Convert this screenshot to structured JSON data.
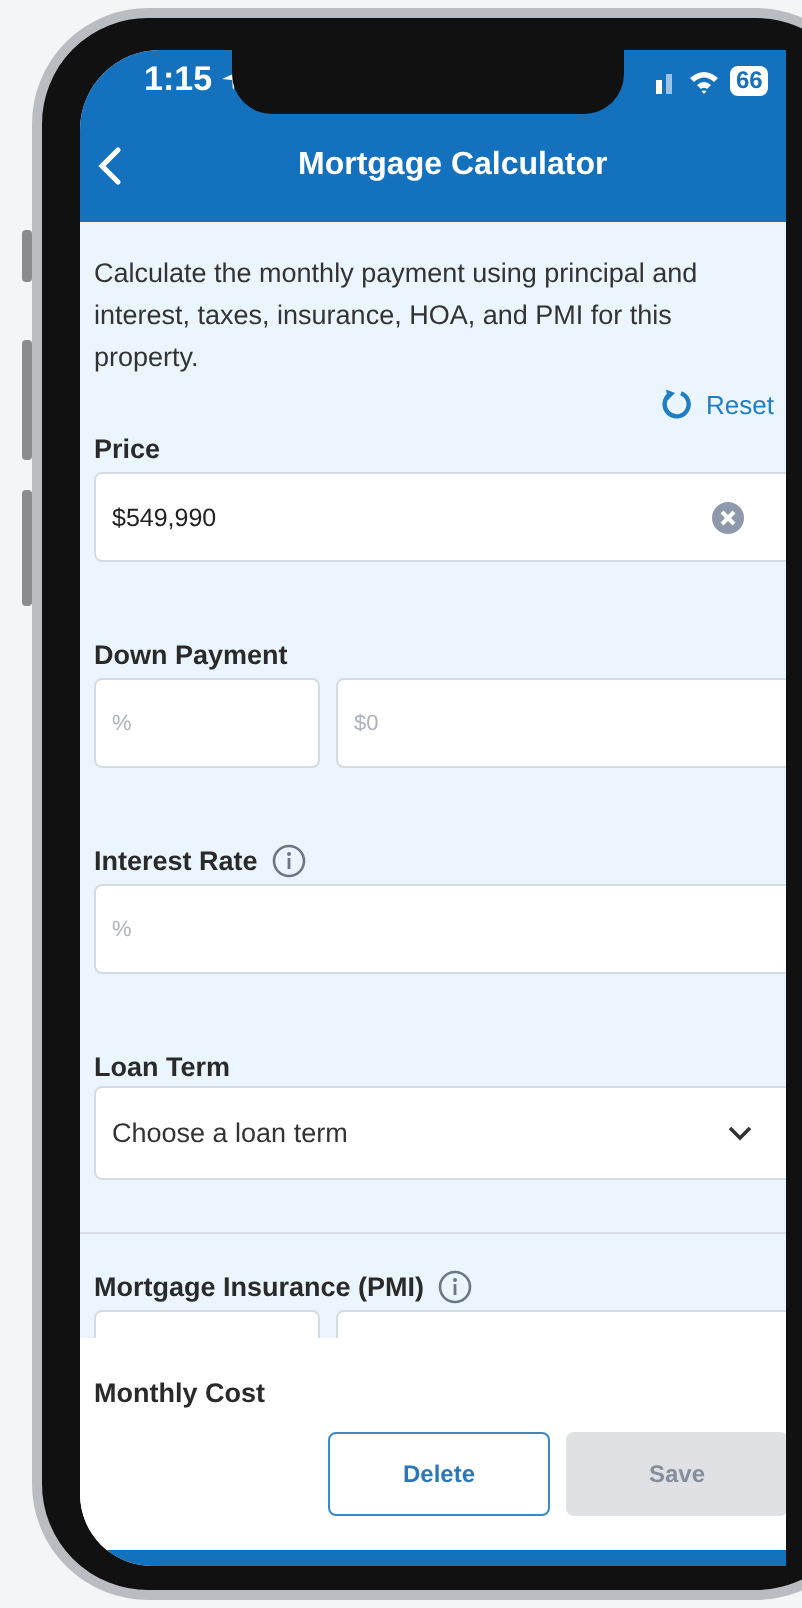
{
  "status_bar": {
    "time": "1:15",
    "battery": "66"
  },
  "header": {
    "title": "Mortgage Calculator"
  },
  "description": "Calculate the monthly payment using principal and interest, taxes, insurance, HOA, and PMI for this property.",
  "reset": "Reset",
  "fields": [
    {
      "kind": "text",
      "label": "Price",
      "value": "$549,990",
      "clearable": true
    },
    {
      "kind": "pair",
      "label": "Down Payment",
      "inputs": [
        {
          "placeholder": "%"
        },
        {
          "placeholder": "$0"
        }
      ]
    },
    {
      "kind": "text",
      "label": "Interest Rate",
      "placeholder": "%",
      "info": true
    },
    {
      "kind": "select",
      "label": "Loan Term",
      "value": "Choose a loan term"
    },
    {
      "kind": "blank_pair",
      "label": "Mortgage Insurance (PMI)",
      "info": true,
      "divider_before": true
    }
  ],
  "footer": {
    "title": "Monthly Cost",
    "buttons": [
      {
        "label": "Delete",
        "disabled": false
      },
      {
        "label": "Save",
        "disabled": true
      }
    ]
  }
}
